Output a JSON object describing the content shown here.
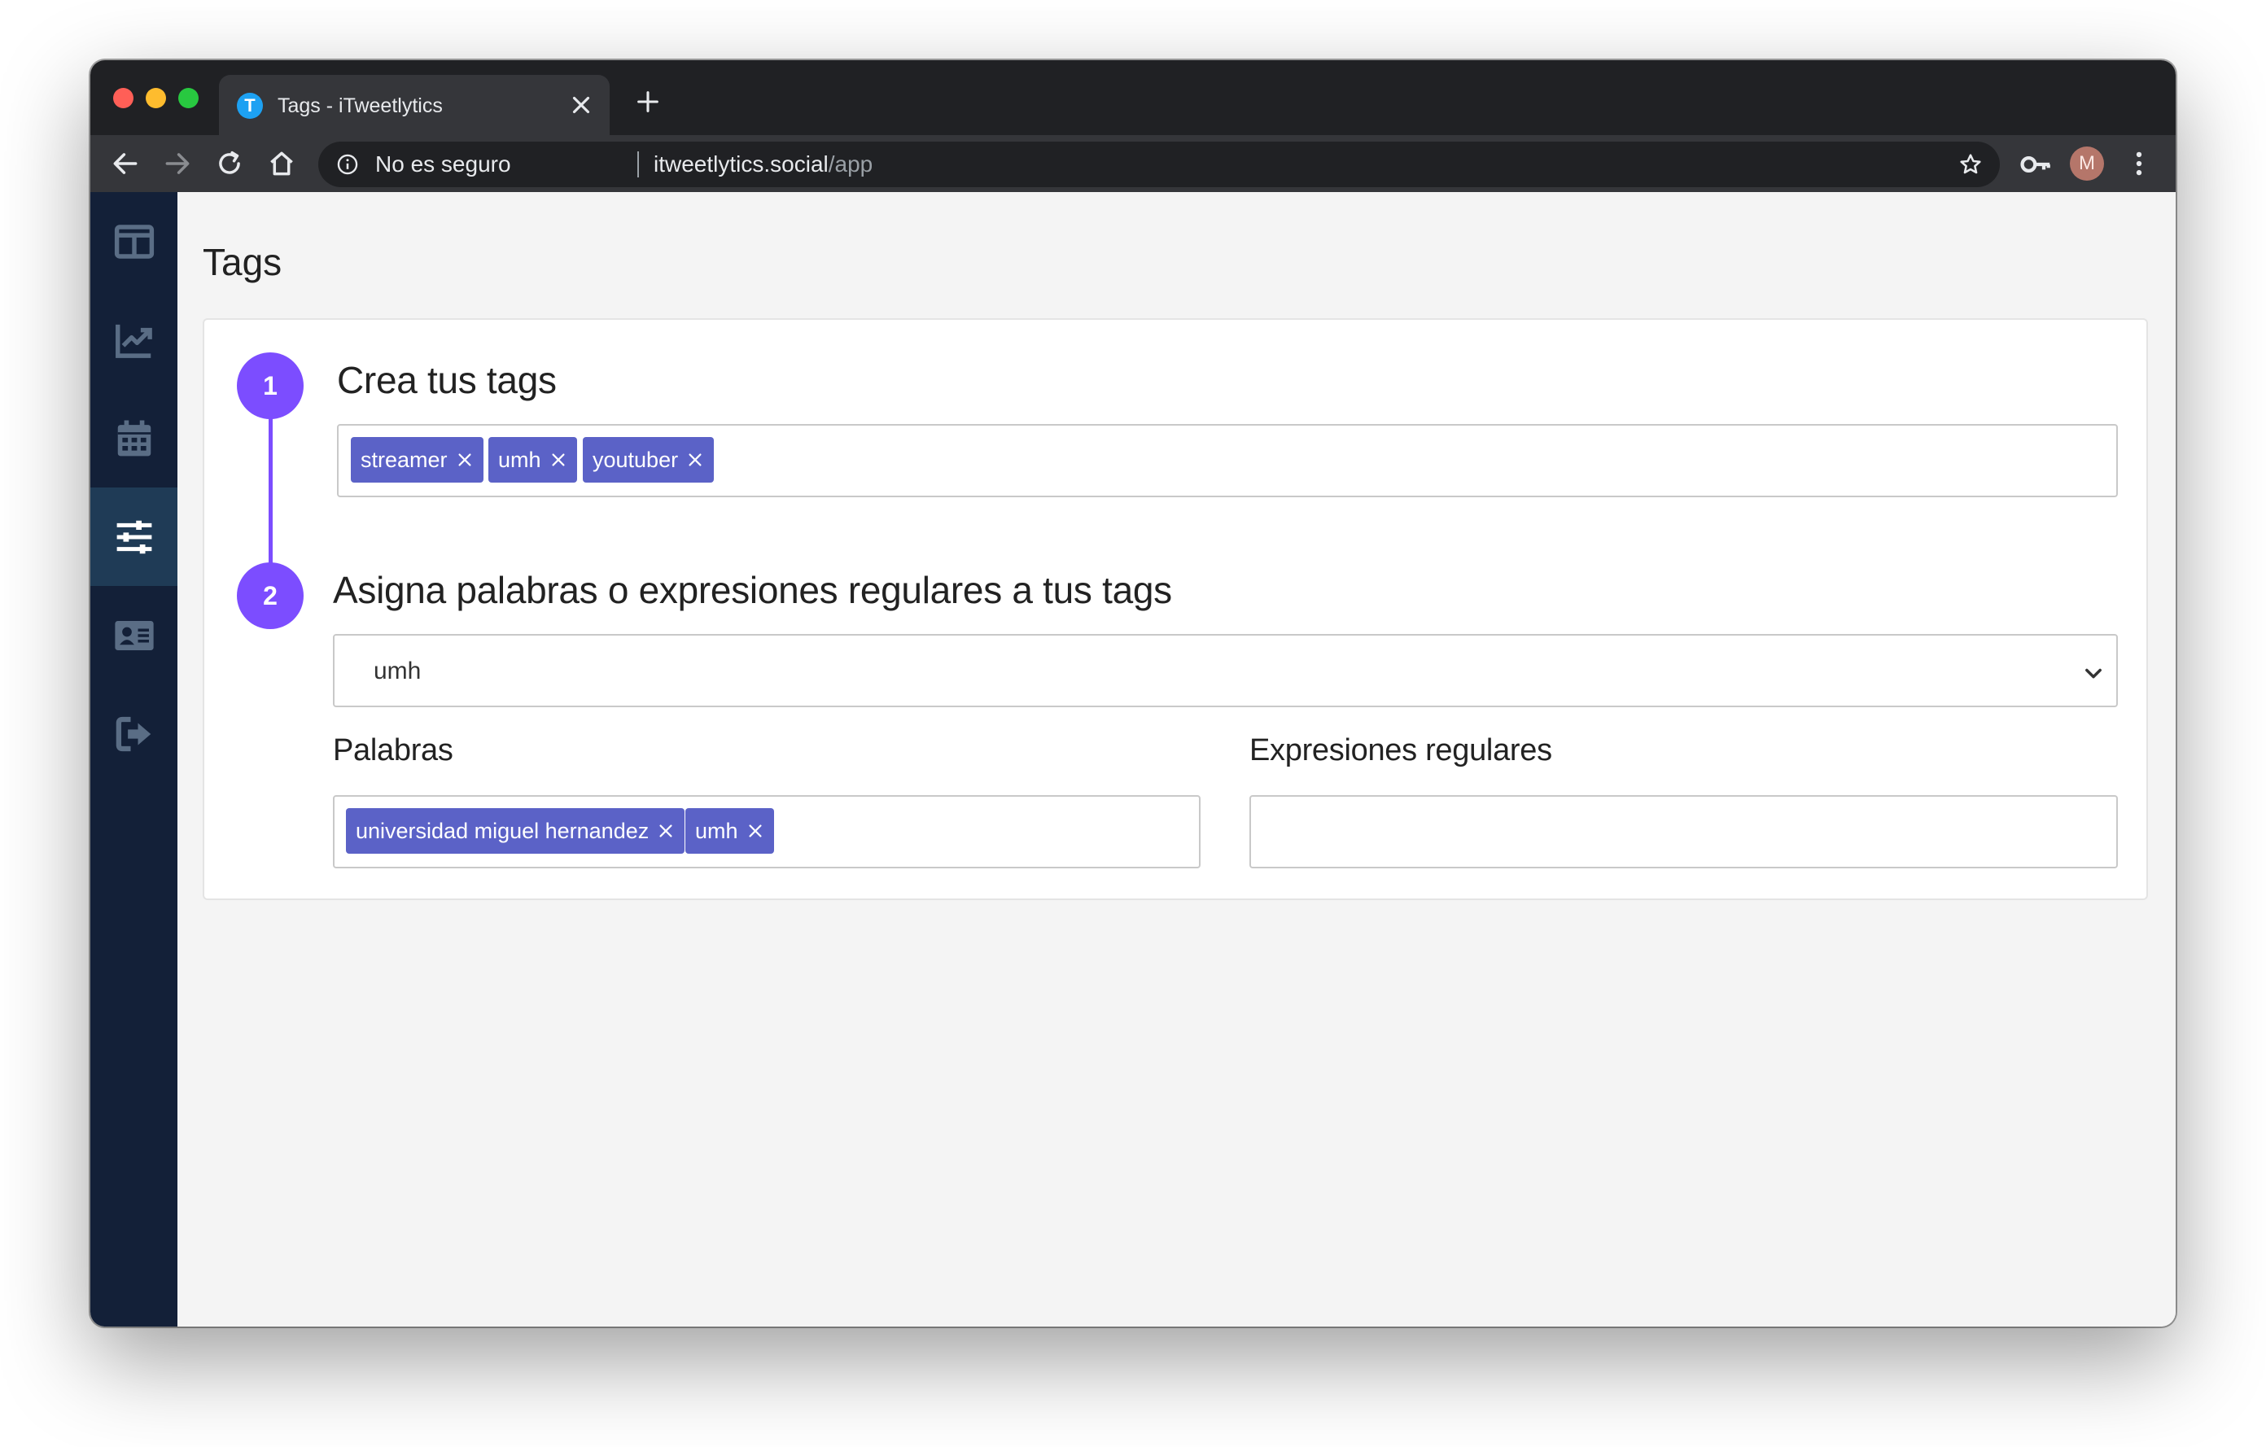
{
  "browser": {
    "tab_title": "Tags - iTweetlytics",
    "favicon_letter": "T",
    "url_security": "No es seguro",
    "url_host": "itweetlytics.social",
    "url_path": "/app",
    "profile_initial": "M"
  },
  "sidebar": {
    "items": [
      {
        "icon": "dashboard-icon"
      },
      {
        "icon": "analytics-chart-icon"
      },
      {
        "icon": "calendar-icon"
      },
      {
        "icon": "sliders-icon",
        "active": true
      },
      {
        "icon": "contact-card-icon"
      },
      {
        "icon": "sign-out-icon"
      }
    ]
  },
  "page": {
    "title": "Tags",
    "step1": {
      "number": "1",
      "heading": "Crea tus tags",
      "tags": [
        "streamer",
        "umh",
        "youtuber"
      ]
    },
    "step2": {
      "number": "2",
      "heading": "Asigna palabras o expresiones regulares a tus tags",
      "selected_tag": "umh",
      "words_label": "Palabras",
      "words": [
        "universidad miguel hernandez",
        "umh"
      ],
      "regex_label": "Expresiones regulares",
      "regexes": []
    }
  },
  "colors": {
    "accent": "#7c4dff",
    "chip": "#5b62c7",
    "sidebar": "#132038",
    "sidebar_active": "#1f3b56"
  }
}
